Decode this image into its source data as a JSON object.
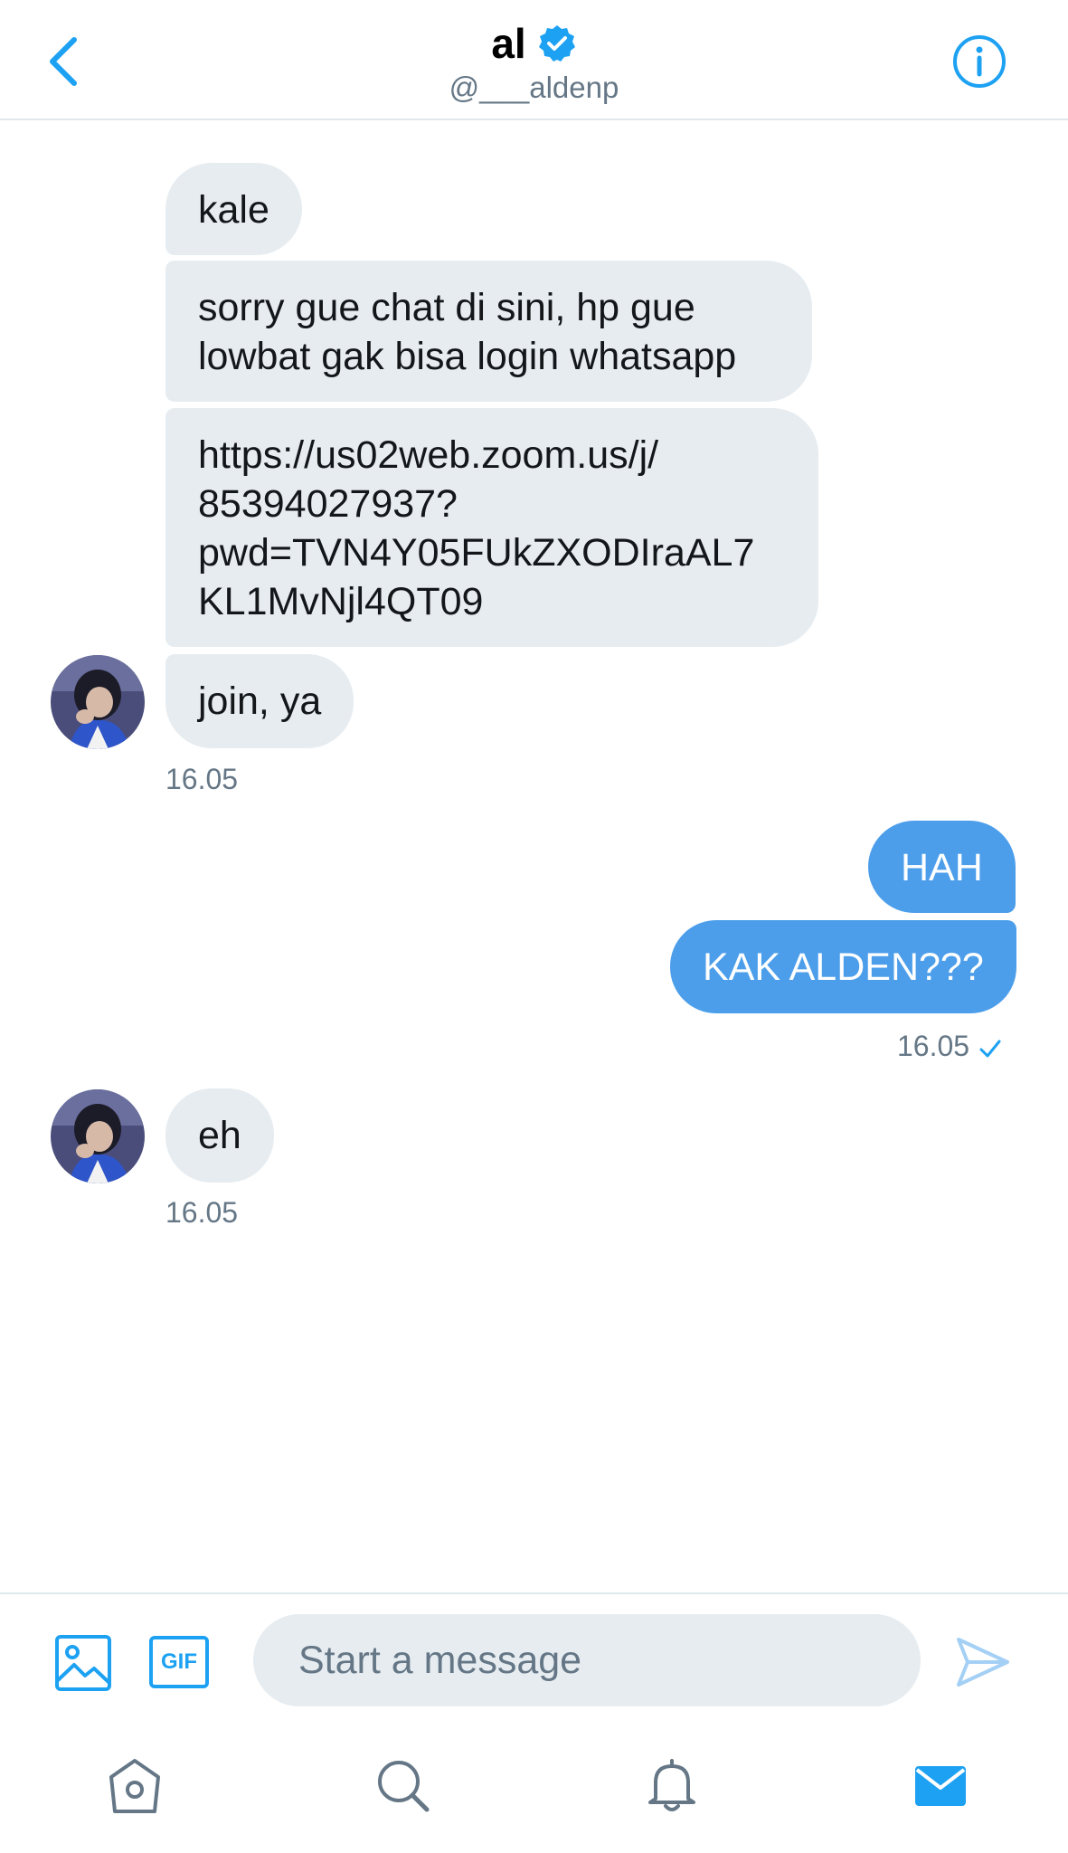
{
  "header": {
    "name": "al",
    "handle": "@___aldenp",
    "icons": {
      "back": "chevron-left-icon",
      "verified": "verified-badge-icon",
      "info": "info-icon"
    }
  },
  "messages": [
    {
      "from": "them",
      "text": "kale"
    },
    {
      "from": "them",
      "text": "sorry gue chat di sini, hp gue\nlowbat gak bisa login whatsapp"
    },
    {
      "from": "them",
      "text": "https://us02web.zoom.us/j/\n85394027937?\npwd=TVN4Y05FUkZXODIraAL7\nKL1MvNjl4QT09"
    },
    {
      "from": "them",
      "text": "join, ya"
    },
    {
      "from": "them_time",
      "text": "16.05"
    },
    {
      "from": "me",
      "text": "HAH"
    },
    {
      "from": "me",
      "text": "KAK ALDEN???"
    },
    {
      "from": "me_time",
      "text": "16.05"
    },
    {
      "from": "them",
      "text": "eh"
    },
    {
      "from": "them_time2",
      "text": "16.05"
    }
  ],
  "composer": {
    "placeholder": "Start a message",
    "gif_label": "GIF",
    "icons": {
      "image": "image-icon",
      "gif": "gif-icon",
      "send": "send-icon"
    }
  },
  "tabbar": {
    "icons": [
      "home-icon",
      "search-icon",
      "notifications-icon",
      "messages-icon"
    ],
    "active": "messages"
  },
  "colors": {
    "accent": "#1da1f2",
    "outgoing_bubble": "#4c9eeb",
    "incoming_bubble": "#e6ecf0",
    "secondary_text": "#657786"
  }
}
